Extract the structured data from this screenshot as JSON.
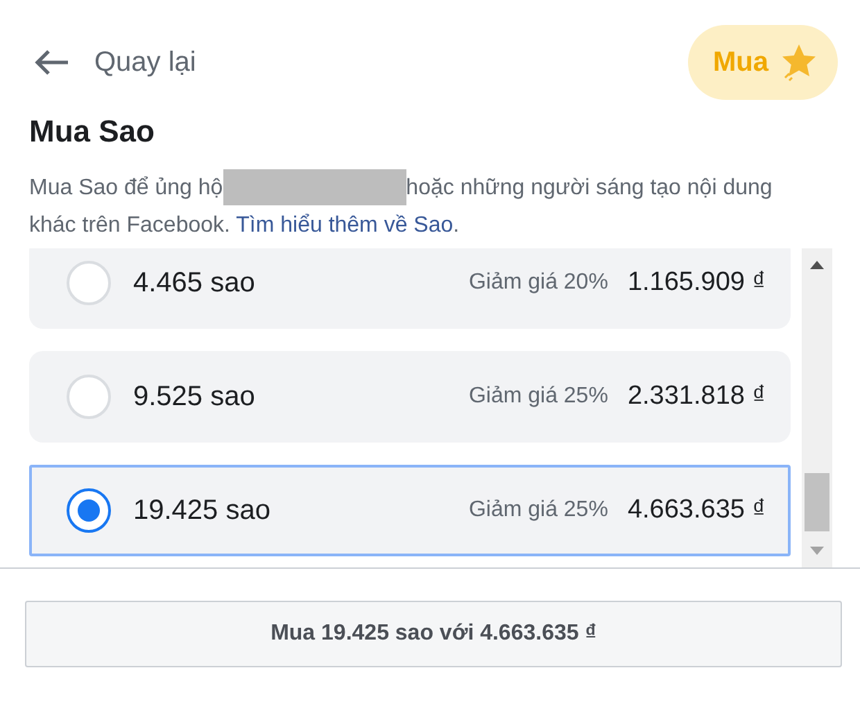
{
  "back": {
    "label": "Quay lại"
  },
  "buy_button": {
    "label": "Mua"
  },
  "title": "Mua Sao",
  "description": {
    "before": "Mua Sao để ủng hộ",
    "redacted": true,
    "after": "hoặc những người sáng tạo nội dung khác trên Facebook.",
    "link": "Tìm hiểu thêm về Sao",
    "end": "."
  },
  "packages": [
    {
      "stars": "4.465 sao",
      "discount": "Giảm giá 20%",
      "price": "1.165.909 ₫",
      "selected": false
    },
    {
      "stars": "9.525 sao",
      "discount": "Giảm giá 25%",
      "price": "2.331.818 ₫",
      "selected": false
    },
    {
      "stars": "19.425 sao",
      "discount": "Giảm giá 25%",
      "price": "4.663.635 ₫",
      "selected": true
    }
  ],
  "confirm_button": {
    "label": "Mua 19.425 sao với 4.663.635 ₫"
  }
}
